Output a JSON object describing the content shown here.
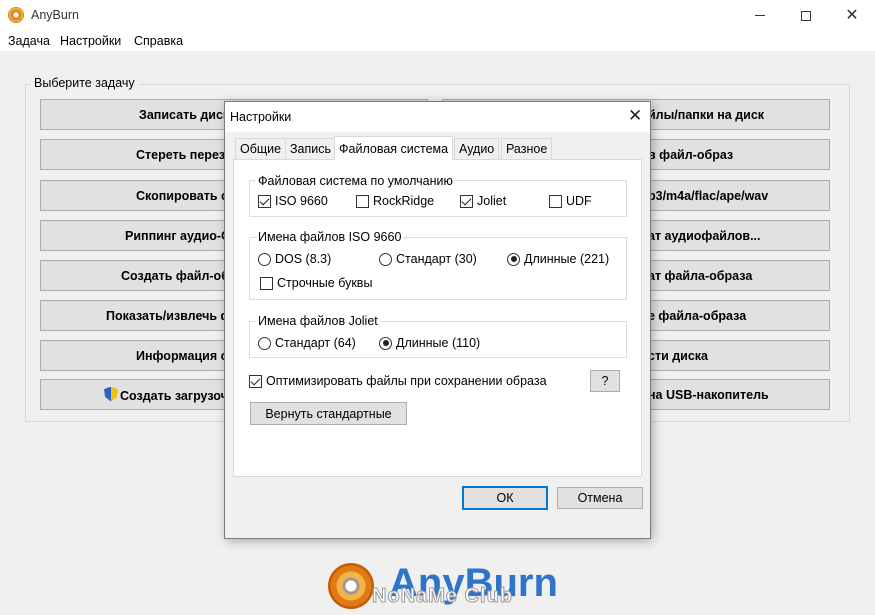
{
  "app": {
    "title": "AnyBurn",
    "menu": [
      "Задача",
      "Настройки",
      "Справка"
    ],
    "group_label": "Выберите задачу",
    "tasks_left": [
      "Записать диск",
      "Стереть переза",
      "Скопировать од",
      "Риппинг аудио-C",
      "Создать файл-обр",
      "Показать/извлечь ф",
      "Информация о",
      "Создать загрузоч"
    ],
    "tasks_right": [
      "йлы/папки на диск",
      "в файл-образ",
      "p3/m4a/flac/ape/wav",
      "ат аудиофайлов...",
      "ат файла-образа",
      "е файла-образа",
      "сти диска",
      "на USB-накопитель"
    ],
    "logo_text": "AnyBurn",
    "watermark": "NoNaMe Club"
  },
  "dialog": {
    "title": "Настройки",
    "tabs": [
      "Общие",
      "Запись",
      "Файловая система",
      "Аудио",
      "Разное"
    ],
    "active_tab": "Файловая система",
    "fs_group": {
      "label": "Файловая система по умолчанию",
      "options": [
        {
          "label": "ISO 9660",
          "checked": true
        },
        {
          "label": "RockRidge",
          "checked": false
        },
        {
          "label": "Joliet",
          "checked": true
        },
        {
          "label": "UDF",
          "checked": false
        }
      ]
    },
    "iso_group": {
      "label": "Имена файлов ISO 9660",
      "radios": [
        {
          "label": "DOS (8.3)",
          "checked": false
        },
        {
          "label": "Стандарт (30)",
          "checked": false
        },
        {
          "label": "Длинные (221)",
          "checked": true
        }
      ],
      "lowercase": {
        "label": "Строчные буквы",
        "checked": false
      }
    },
    "joliet_group": {
      "label": "Имена файлов Joliet",
      "radios": [
        {
          "label": "Стандарт (64)",
          "checked": false
        },
        {
          "label": "Длинные (110)",
          "checked": true
        }
      ]
    },
    "optimize": {
      "label": "Оптимизировать файлы при сохранении образа",
      "checked": true
    },
    "help_label": "?",
    "reset_label": "Вернуть стандартные",
    "ok_label": "ОК",
    "cancel_label": "Отмена"
  },
  "colors": {
    "accent": "#0078d7",
    "logo_blue": "#2e74c8",
    "logo_orange": "#e07a12"
  }
}
